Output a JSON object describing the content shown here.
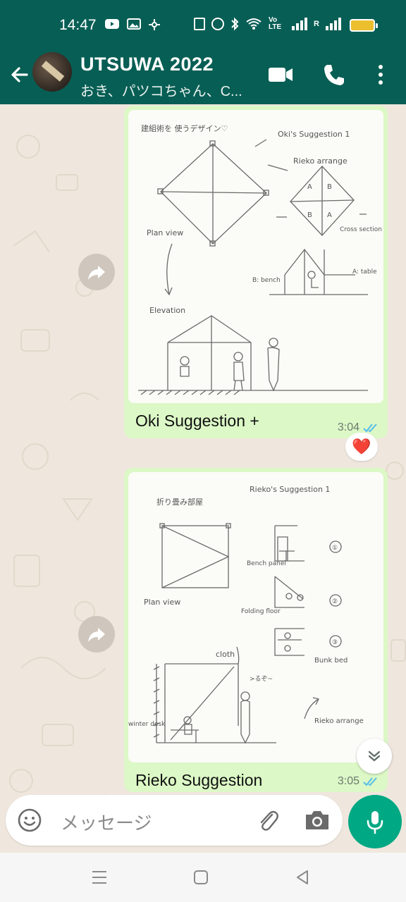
{
  "status_bar": {
    "time": "14:47",
    "network_label": "Vo LTE",
    "sim_label": "R",
    "battery_color": "#ecbf2f"
  },
  "header": {
    "title": "UTSUWA 2022",
    "subtitle": "おき、パツコちゃん、C...",
    "icons": [
      "back-arrow-icon",
      "group-avatar",
      "video-call-icon",
      "phone-icon",
      "more-options-icon"
    ]
  },
  "messages": [
    {
      "caption": "Oki Suggestion +",
      "time": "3:04",
      "status": "read",
      "reaction": "❤️",
      "sketch_labels": {
        "title_jp": "建組術を\n使うデザイン♡",
        "suggestion": "Oki's Suggestion 1",
        "arrange": "Rieko arrange",
        "plan_view": "Plan view",
        "cross_section": "Cross section position",
        "bench": "B: bench",
        "table": "A: table",
        "elevation": "Elevation"
      }
    },
    {
      "caption": "Rieko Suggestion",
      "time": "3:05",
      "status": "read",
      "sketch_labels": {
        "title_jp": "折り畳み部屋",
        "suggestion": "Rieko's Suggestion 1",
        "plan_view": "Plan view",
        "bench_panel": "Bench panel",
        "folding_floor": "Folding floor",
        "bunk_bed": "Bunk bed",
        "cloth": "cloth",
        "speech": ">るぞ~",
        "winter_desk": "winter desk",
        "rieko_arrange": "Rieko arrange",
        "n1": "①",
        "n2": "②",
        "n3": "③"
      }
    }
  ],
  "composer": {
    "placeholder": "メッセージ"
  },
  "colors": {
    "header_bg": "#075e54",
    "bubble_out": "#dcf8c6",
    "chat_bg": "#efe7dd",
    "read_tick": "#53bdeb",
    "fab": "#00a884"
  }
}
